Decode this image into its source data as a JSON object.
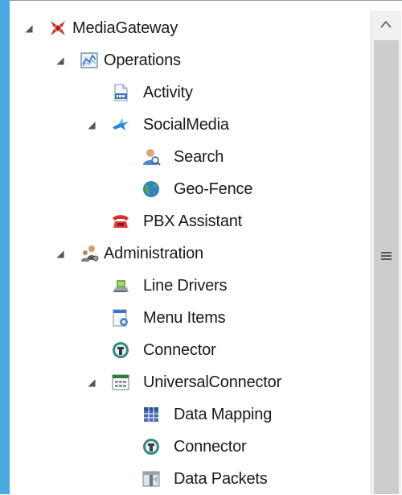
{
  "tree": {
    "items": [
      {
        "label": "MediaGateway",
        "icon": "media-gateway-icon",
        "expanded": true
      },
      {
        "label": "Operations",
        "icon": "operations-chart-icon",
        "expanded": true
      },
      {
        "label": "Activity",
        "icon": "log-document-icon"
      },
      {
        "label": "SocialMedia",
        "icon": "social-bird-icon",
        "expanded": true
      },
      {
        "label": "Search",
        "icon": "user-search-icon"
      },
      {
        "label": "Geo-Fence",
        "icon": "globe-icon"
      },
      {
        "label": "PBX Assistant",
        "icon": "phone-icon"
      },
      {
        "label": "Administration",
        "icon": "admin-users-icon",
        "expanded": true
      },
      {
        "label": "Line Drivers",
        "icon": "line-drivers-icon"
      },
      {
        "label": "Menu Items",
        "icon": "menu-items-icon"
      },
      {
        "label": "Connector",
        "icon": "connector-icon"
      },
      {
        "label": "UniversalConnector",
        "icon": "universal-connector-icon",
        "expanded": true
      },
      {
        "label": "Data Mapping",
        "icon": "grid-table-icon"
      },
      {
        "label": "Connector",
        "icon": "connector-icon"
      },
      {
        "label": "Data Packets",
        "icon": "data-packets-icon"
      }
    ]
  },
  "scrollbar": {
    "up_icon": "chevron-up-icon",
    "grip_icon": "grip-icon"
  },
  "colors": {
    "accent": "#49a9e0",
    "thumb": "#cdcdcd",
    "track": "#f0f0f0"
  }
}
